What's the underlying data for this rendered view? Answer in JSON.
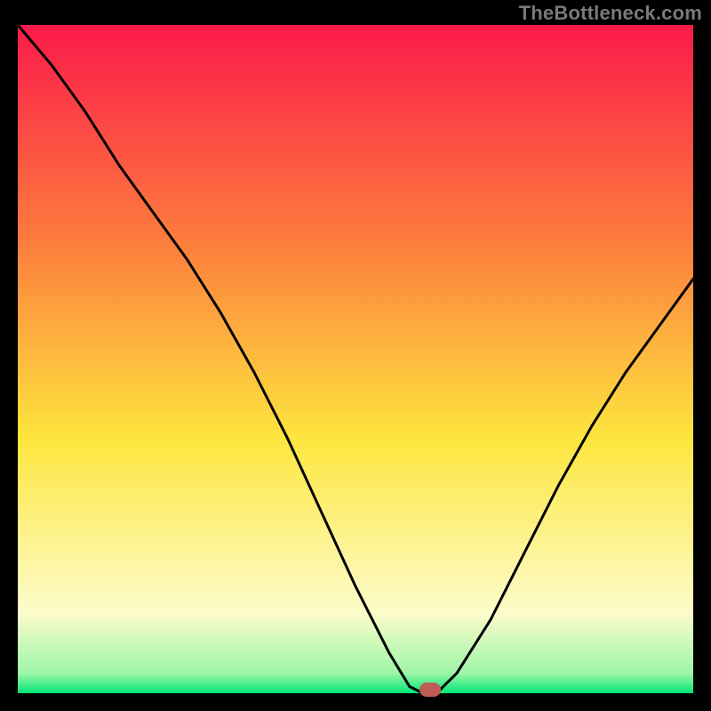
{
  "attribution": "TheBottleneck.com",
  "colors": {
    "gradient_top": "#fb1a4a",
    "gradient_mid_top": "#fd7f3d",
    "gradient_mid": "#fde63e",
    "gradient_low": "#fdfccb",
    "gradient_base": "#00e576",
    "background": "#000000",
    "curve": "#000000",
    "marker": "#be5b55"
  },
  "chart_data": {
    "type": "line",
    "title": "",
    "xlabel": "",
    "ylabel": "",
    "xlim": [
      0,
      100
    ],
    "ylim": [
      0,
      100
    ],
    "series": [
      {
        "name": "bottleneck-curve",
        "x": [
          0,
          5,
          10,
          15,
          20,
          25,
          30,
          35,
          40,
          45,
          50,
          55,
          58,
          60,
          62,
          65,
          70,
          75,
          80,
          85,
          90,
          95,
          100
        ],
        "y": [
          100,
          94,
          87,
          79,
          72,
          65,
          57,
          48,
          38,
          27,
          16,
          6,
          1,
          0,
          0,
          3,
          11,
          21,
          31,
          40,
          48,
          55,
          62
        ]
      }
    ],
    "annotations": [
      {
        "name": "optimal-marker",
        "x": 61,
        "y": 0.5
      }
    ]
  }
}
